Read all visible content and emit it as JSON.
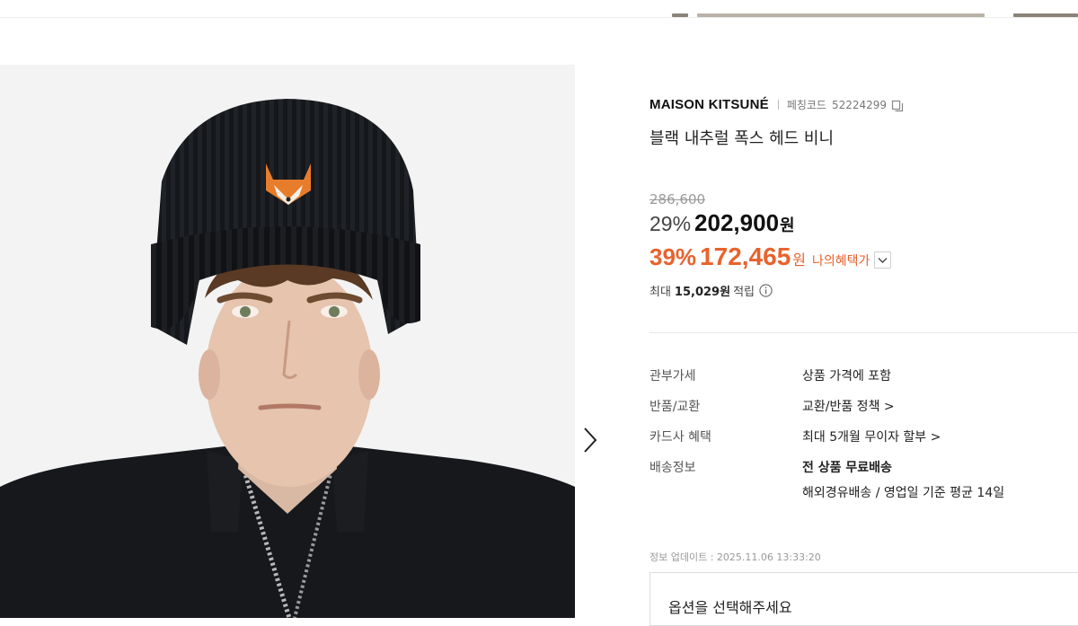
{
  "product": {
    "brand": "MAISON KITSUNÉ",
    "code_label": "페칭코드",
    "code": "52224299",
    "title": "블랙 내추럴 폭스 헤드 비니",
    "image_alt": "Model wearing black ribbed beanie with fox head patch",
    "image_icon": "product-photo"
  },
  "pricing": {
    "original": "286,600",
    "discount1": "29%",
    "price1": "202,900",
    "currency1": "원",
    "discount2": "39%",
    "price2": "172,465",
    "currency2": "원",
    "benefit_label": "나의혜택가",
    "points_prefix": "최대",
    "points_amount": "15,029원",
    "points_suffix": "적립",
    "accent_color": "#e8622d"
  },
  "specs": [
    {
      "label": "관부가세",
      "value": "상품 가격에 포함"
    },
    {
      "label": "반품/교환",
      "value": "교환/반품 정책 >"
    },
    {
      "label": "카드사 혜택",
      "value": "최대 5개월 무이자 할부 >"
    },
    {
      "label": "배송정보",
      "value": "전 상품 무료배송",
      "value2": "해외경유배송 / 영업일 기준 평균 14일"
    }
  ],
  "updated": "정보 업데이트 : 2025.11.06 13:33:20",
  "option_placeholder": "옵션을 선택해주세요"
}
